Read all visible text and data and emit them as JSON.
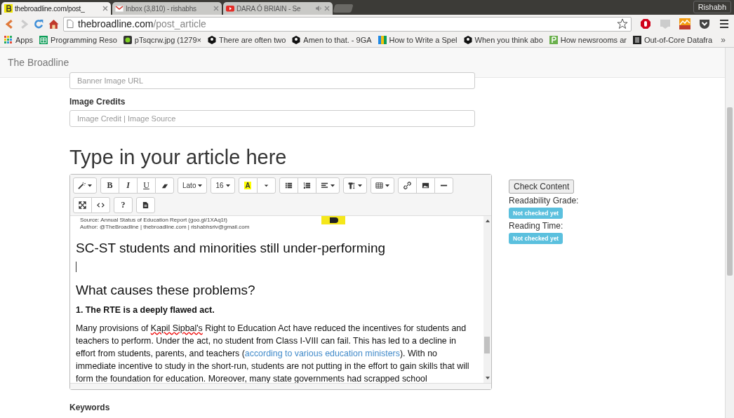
{
  "browser": {
    "tabs": [
      {
        "title": "thebroadline.com/post_",
        "selected": true,
        "audio": false
      },
      {
        "title": "Inbox (3,810) - rishabhs",
        "selected": false,
        "audio": false
      },
      {
        "title": "DARA Ó BRIAIN - Se",
        "selected": false,
        "audio": true
      }
    ],
    "profile": "Rishabh",
    "address": {
      "host": "thebroadline.com",
      "path": "/post_article"
    },
    "bookmarks": [
      {
        "label": "Apps"
      },
      {
        "label": "Programming Reso"
      },
      {
        "label": "pTsqcrw.jpg (1279×"
      },
      {
        "label": "There are often two"
      },
      {
        "label": "Amen to that. - 9GA"
      },
      {
        "label": "How to Write a Spel"
      },
      {
        "label": "When you think abo"
      },
      {
        "label": "How newsrooms ar"
      },
      {
        "label": "Out-of-Core Datafra"
      }
    ],
    "more": "»"
  },
  "site": {
    "brand": "The Broadline"
  },
  "form": {
    "banner_placeholder": "Banner Image URL",
    "credits_label": "Image Credits",
    "credits_placeholder": "Image Credit | Image Source",
    "heading": "Type in your article here"
  },
  "toolbar": [
    [
      {
        "caret": true
      }
    ],
    [
      {
        "label": "B"
      },
      {
        "label": "I"
      },
      {
        "label": "U"
      },
      {
        "caret": false
      }
    ],
    [
      {
        "label": "Lato",
        "caret": true
      }
    ],
    [
      {
        "label": "16",
        "caret": true
      }
    ],
    [
      {
        "label": "A"
      },
      {
        "caret": false
      }
    ],
    [
      {
        "caret": false
      },
      {
        "caret": false
      },
      {
        "caret": true
      }
    ],
    [
      {
        "caret": true
      }
    ],
    [
      {
        "caret": true
      }
    ],
    [
      {
        "caret": false
      },
      {
        "caret": false
      },
      {
        "caret": false
      }
    ],
    [
      {
        "caret": false
      },
      {
        "caret": false
      }
    ],
    [
      {
        "label": "?"
      }
    ],
    [
      {
        "caret": false
      }
    ]
  ],
  "content": [
    {
      "kind": "caption",
      "text": "Source: Annual Status of Education Report (goo.gl/1XAq1t)"
    },
    {
      "kind": "caption",
      "text": "Author: @TheBroadline | thebroadline.com | rishabhsriv@gmail.com"
    },
    {
      "kind": "heading",
      "text": "SC-ST students and minorities still under-performing"
    },
    {
      "kind": "cursor"
    },
    {
      "kind": "heading",
      "text": "What causes these problems?"
    },
    {
      "kind": "bold",
      "text": "1. The RTE is a deeply flawed act."
    },
    {
      "kind": "paragraph",
      "parts": [
        {
          "kind": "plain",
          "text": "Many provisions of "
        },
        {
          "kind": "misspelled",
          "text": "Kapil Sipbal's"
        },
        {
          "kind": "plain",
          "text": " Right to Education Act have reduced the incentives for students and teachers to perform. Under the act, no student from Class I-VIII can fail. This has led to a decline in effort from students, parents, and teachers ("
        },
        {
          "kind": "link",
          "text": "according to various education ministers"
        },
        {
          "kind": "plain",
          "text": "). With no immediate incentive to study in the short-run, students are not putting in the effort to gain skills that will form the foundation for education. Moreover, many state governments had scrapped school"
        }
      ]
    }
  ],
  "side": {
    "button": "Check Content",
    "stats": [
      {
        "label": "Readability Grade:",
        "value": "Not checked yet"
      },
      {
        "label": "Reading Time:",
        "value": "Not checked yet"
      }
    ]
  },
  "keywords_label": "Keywords"
}
